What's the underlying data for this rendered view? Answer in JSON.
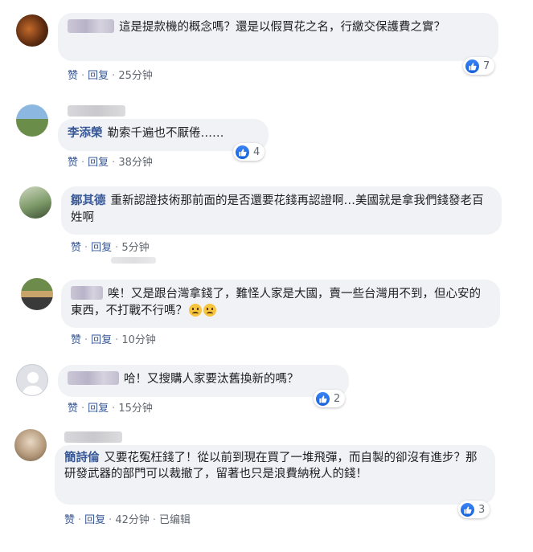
{
  "comments": [
    {
      "name": "",
      "text": "這是提款機的概念嗎？還是以假買花之名，行繳交保護費之實？",
      "actions": {
        "like": "赞",
        "reply": "回复",
        "time": "25分钟"
      },
      "reactions": "7"
    },
    {
      "name": "李添榮",
      "text": "勒索千遍也不厭倦……",
      "actions": {
        "like": "赞",
        "reply": "回复",
        "time": "38分钟"
      },
      "reactions": "4"
    },
    {
      "name": "鄒其德",
      "text": "重新認證技術那前面的是否還要花錢再認證啊…美國就是拿我們錢發老百姓啊",
      "actions": {
        "like": "赞",
        "reply": "回复",
        "time": "5分钟"
      },
      "reactions": ""
    },
    {
      "name": "",
      "text": "唉！又是跟台灣拿錢了，難怪人家是大國，賣一些台灣用不到，但心安的東西，不打戰不行嗎？",
      "actions": {
        "like": "赞",
        "reply": "回复",
        "time": "10分钟"
      },
      "reactions": ""
    },
    {
      "name": "",
      "text": "哈！又搜購人家要汰舊換新的嗎？",
      "actions": {
        "like": "赞",
        "reply": "回复",
        "time": "15分钟"
      },
      "reactions": "2"
    },
    {
      "name": "簡詩倫",
      "text": "又要花冤枉錢了！從以前到現在買了一堆飛彈，而自製的卻沒有進步？那研發武器的部門可以裁撤了，留著也只是浪費納稅人的錢！",
      "actions": {
        "like": "赞",
        "reply": "回复",
        "time": "42分钟",
        "edited": "已编辑"
      },
      "reactions": "3"
    }
  ],
  "icons": {
    "reaction": "like-thumb-icon",
    "emoji": "sad-face-emoji"
  },
  "colors": {
    "link": "#385898",
    "bubble": "#f0f2f5",
    "like": "#1877f2"
  }
}
